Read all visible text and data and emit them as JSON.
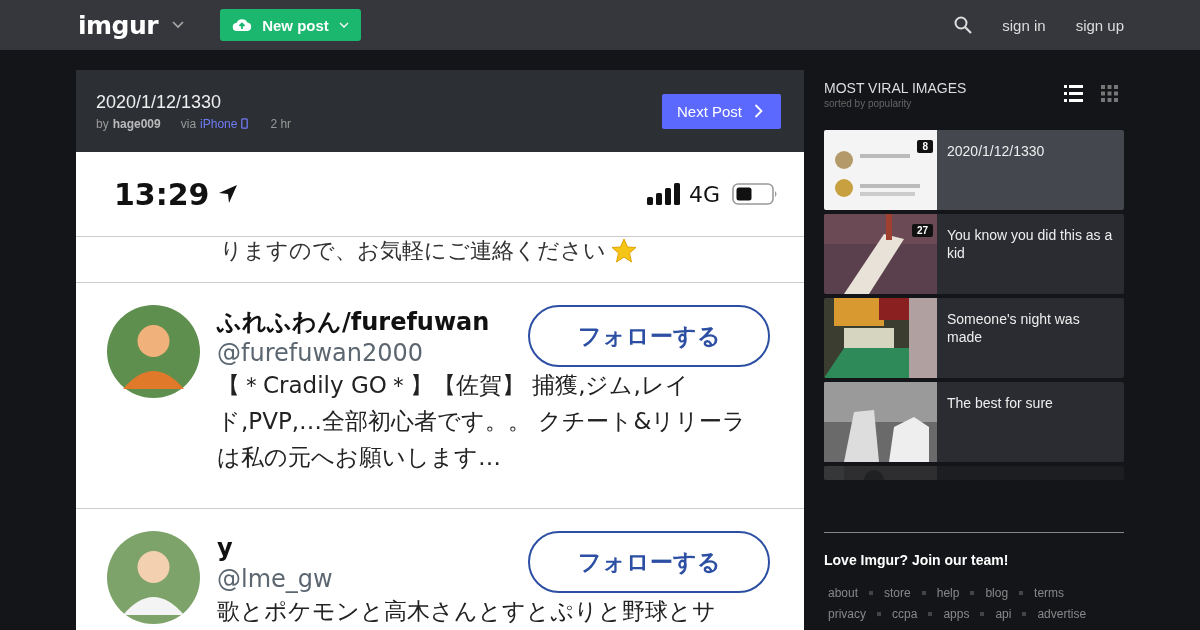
{
  "header": {
    "logo": "imgur",
    "new_post": "New post",
    "actions": [
      "sign in",
      "sign up"
    ]
  },
  "post": {
    "title": "2020/1/12/1330",
    "by": "by",
    "author": "hage009",
    "via": "via",
    "source": "iPhone",
    "age": "2 hr",
    "next": "Next Post",
    "screenshot": {
      "time": "13:29",
      "network": "4G",
      "cut_line": "りますので、お気軽にご連絡ください",
      "accounts": [
        {
          "name": "ふれふわん/furefuwan",
          "handle": "@furefuwan2000",
          "follow": "フォローする",
          "bio": "【＊Cradily GO＊】【佐賀】 捕獲,ジム,レイド,PVP,…全部初心者です。。 クチート&リリーラは私の元へお願いします…"
        },
        {
          "name": "y",
          "handle": "@lme_gw",
          "follow": "フォローする",
          "bio": "歌とポケモンと高木さんとすとぷりと野球とサ"
        }
      ]
    }
  },
  "sidebar": {
    "title": "MOST VIRAL IMAGES",
    "subtitle": "sorted by popularity",
    "views": [
      {
        "kind": "list",
        "selected": true
      },
      {
        "kind": "grid",
        "selected": false
      }
    ],
    "items": [
      {
        "title": "2020/1/12/1330",
        "count": "8",
        "selected": true
      },
      {
        "title": "You know you did this as a kid",
        "count": "27",
        "selected": false
      },
      {
        "title": "Someone's night was made",
        "selected": false
      },
      {
        "title": "The best for sure",
        "selected": false
      }
    ]
  },
  "footer": {
    "heading": "Love Imgur? Join our team!",
    "links": [
      [
        "about",
        "store",
        "help",
        "blog",
        "terms"
      ],
      [
        "privacy",
        "ccpa",
        "apps",
        "api",
        "advertise"
      ]
    ]
  }
}
